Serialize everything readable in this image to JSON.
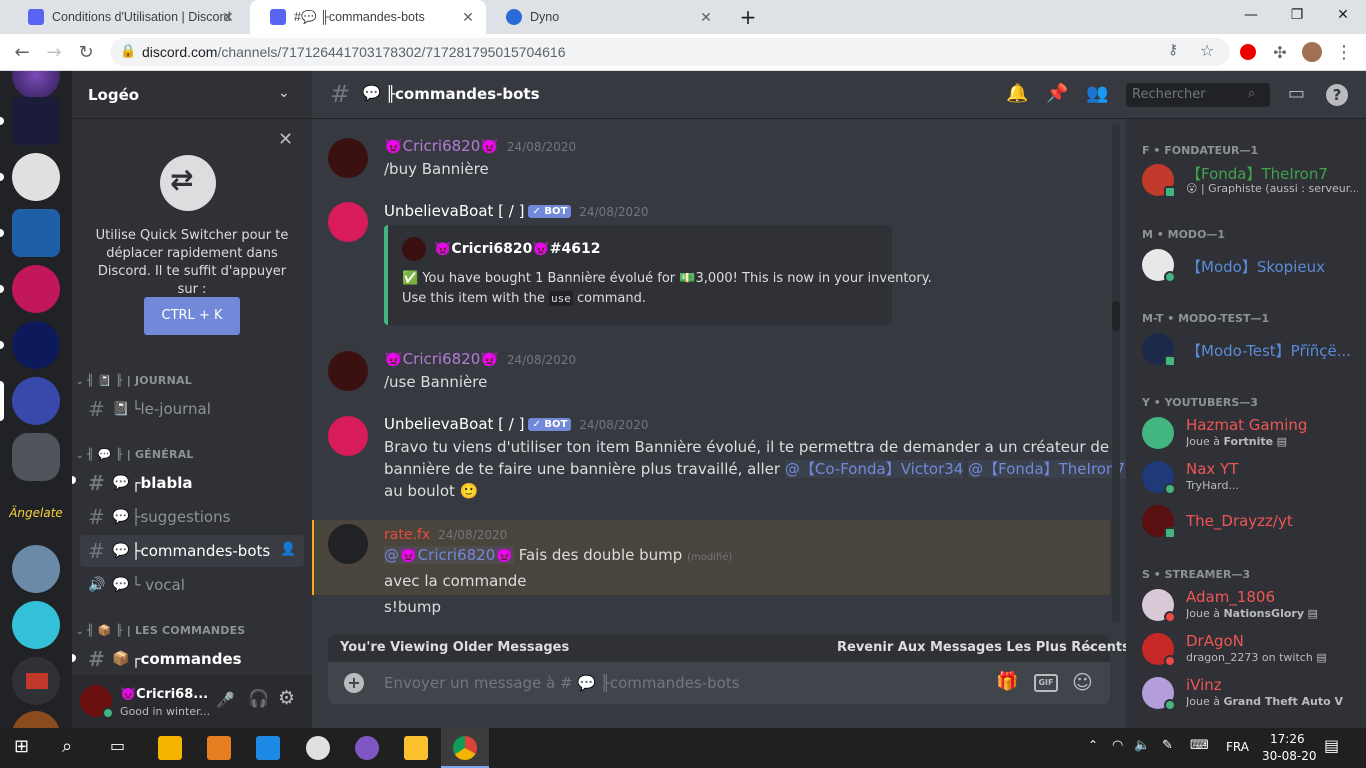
{
  "browser": {
    "tabs": [
      {
        "title": "Conditions d'Utilisation | Discord",
        "active": false
      },
      {
        "title": "#💬 ╟commandes-bots",
        "active": true
      },
      {
        "title": "Dyno",
        "active": false
      }
    ],
    "url_host": "discord.com",
    "url_path": "/channels/717126441703178302/717281795015704616"
  },
  "server": {
    "name": "Logéo",
    "quick_switcher": {
      "text": "Utilise Quick Switcher pour te déplacer rapidement dans Discord. Il te suffit d'appuyer sur :",
      "button": "CTRL + K"
    },
    "categories": [
      {
        "label": "╢ 📓 ╟ | JOURNAL"
      },
      {
        "label": "╢ 💬 ╟ | GÉNÉRAL"
      },
      {
        "label": "╢ 📦 ╟ | LES COMMANDES"
      }
    ],
    "channels": [
      {
        "name": "└le-journal",
        "emoji": "📓",
        "type": "text"
      },
      {
        "name": "┌blabla",
        "emoji": "💬",
        "type": "text"
      },
      {
        "name": "├suggestions",
        "emoji": "💬",
        "type": "text"
      },
      {
        "name": "├commandes-bots",
        "emoji": "💬",
        "type": "text"
      },
      {
        "name": "└ vocal",
        "emoji": "💬",
        "type": "voice"
      },
      {
        "name": "┌commandes",
        "emoji": "📦",
        "type": "text"
      }
    ]
  },
  "user": {
    "name": "👿Cricri68...",
    "status": "Good in winter..."
  },
  "chat": {
    "channel_title": "╟commandes-bots",
    "search_placeholder": "Rechercher",
    "messages": [
      {
        "author": "👿Cricri6820👿",
        "timestamp": "24/08/2020",
        "lines": [
          "/buy Bannière"
        ]
      },
      {
        "author": "UnbelievaBoat [ / ]",
        "bot_label": "✓ BOT",
        "timestamp": "24/08/2020",
        "embed_author": "👿Cricri6820👿#4612",
        "embed_line1": "You have bought 1 Bannière évolué for",
        "embed_amount": "3,000! This is now in your inventory.",
        "embed_line2_pre": "Use this item with the",
        "embed_code": "use",
        "embed_line2_post": "command."
      },
      {
        "author": "👿Cricri6820👿",
        "timestamp": "24/08/2020",
        "lines": [
          "/use Bannière"
        ]
      },
      {
        "author": "UnbelievaBoat [ / ]",
        "bot_label": "✓ BOT",
        "timestamp": "24/08/2020",
        "line1": "Bravo tu viens d'utiliser ton item Bannière évolué, il te permettra de demander a un créateur de",
        "line2_pre": "bannière de te faire une bannière plus travaillé, aller",
        "mention1": "@【Co-Fonda】Victor34",
        "mention2": "@【Fonda】TheIron7",
        "line3": "au boulot 🙂"
      },
      {
        "author": "rate.fx",
        "timestamp": "24/08/2020",
        "mention": "@👿Cricri6820👿",
        "text": "Fais des double bump",
        "edited": "(modifié)",
        "line2": "avec la commande",
        "line3": "s!bump"
      }
    ],
    "older_banner": "You're Viewing Older Messages",
    "jump_label": "Revenir Aux Messages Les Plus Récents",
    "composer_placeholder_pre": "Envoyer un message à #",
    "composer_placeholder_post": "╟commandes-bots"
  },
  "members": {
    "groups": [
      {
        "role": "F • FONDATEUR—1",
        "members": [
          {
            "name": "【Fonda】TheIron7",
            "sub": "😮 | Graphiste (aussi : serveur..."
          }
        ]
      },
      {
        "role": "M • MODO—1",
        "members": [
          {
            "name": "【Modo】Skopieux",
            "sub": ""
          }
        ]
      },
      {
        "role": "M-T • MODO-TEST—1",
        "members": [
          {
            "name": "【Modo-Test】Přïñçë...",
            "sub": ""
          }
        ]
      },
      {
        "role": "Y • YOUTUBERS—3",
        "members": [
          {
            "name": "Hazmat Gaming",
            "sub_pre": "Joue à",
            "sub_bold": "Fortnite"
          },
          {
            "name": "Nax YT",
            "sub": "TryHard..."
          },
          {
            "name": "The_Drayzz/yt",
            "sub": ""
          }
        ]
      },
      {
        "role": "S • STREAMER—3",
        "members": [
          {
            "name": "Adam_1806",
            "sub_pre": "Joue à",
            "sub_bold": "NationsGlory"
          },
          {
            "name": "DrAgoN",
            "sub": "dragon_2273 on twitch"
          },
          {
            "name": "iVinz",
            "sub_pre": "Joue à",
            "sub_bold": "Grand Theft Auto V"
          }
        ]
      }
    ]
  },
  "taskbar": {
    "lang": "FRA",
    "time": "17:26",
    "date": "30-08-20"
  },
  "colors": {
    "fondateur": "#3fa34d",
    "modo": "#5b8bd6",
    "youtuber": "#e74c3c",
    "streamer": "#f05555",
    "cricri": "#b37cd6",
    "bot": "#ffffff",
    "ratefx": "#e74c3c"
  }
}
